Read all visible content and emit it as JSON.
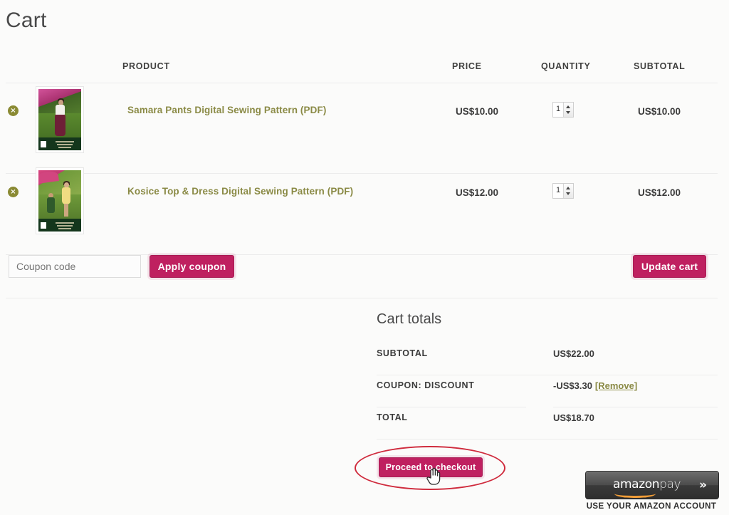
{
  "page": {
    "title": "Cart",
    "accent_crimson": "#bf2060",
    "accent_olive": "#8a8a45",
    "highlight_red": "#cf2a3c",
    "background": "#fbfbfa"
  },
  "table": {
    "headers": {
      "product": "PRODUCT",
      "price": "PRICE",
      "quantity": "QUANTITY",
      "subtotal": "SUBTOTAL"
    },
    "rows": [
      {
        "remove_label": "×",
        "thumbnail_alt": "samara-pants-pattern-cover",
        "name": "Samara Pants Digital Sewing Pattern (PDF)",
        "price": "US$10.00",
        "quantity": "1",
        "subtotal": "US$10.00"
      },
      {
        "remove_label": "×",
        "thumbnail_alt": "kosice-top-dress-pattern-cover",
        "name": "Kosice Top & Dress Digital Sewing Pattern (PDF)",
        "price": "US$12.00",
        "quantity": "1",
        "subtotal": "US$12.00"
      }
    ]
  },
  "coupon": {
    "placeholder": "Coupon code",
    "value": "",
    "apply_label": "Apply coupon",
    "update_cart_label": "Update cart"
  },
  "totals": {
    "title": "Cart totals",
    "rows": [
      {
        "label": "SUBTOTAL",
        "value": "US$22.00",
        "remove": ""
      },
      {
        "label": "COUPON: DISCOUNT",
        "value": "-US$3.30",
        "remove": "[Remove]"
      },
      {
        "label": "TOTAL",
        "value": "US$18.70",
        "remove": ""
      }
    ]
  },
  "checkout": {
    "proceed_label": "Proceed to checkout"
  },
  "amazon_pay": {
    "wordmark_amazon": "amazon",
    "wordmark_pay": "pay",
    "chevrons": "»",
    "caption": "USE YOUR AMAZON ACCOUNT"
  }
}
